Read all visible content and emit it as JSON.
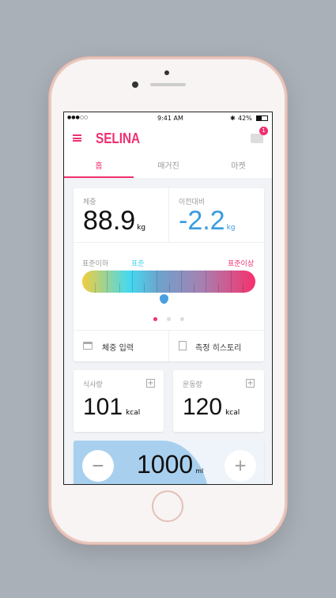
{
  "status": {
    "signal": "●●●○○",
    "time": "9:41 AM",
    "bluetooth": "✱",
    "battery": "42%"
  },
  "header": {
    "brand": "SELINA",
    "badge": "1",
    "accent": "#f0306f"
  },
  "tabs": [
    {
      "label": "홈",
      "active": true
    },
    {
      "label": "매거진"
    },
    {
      "label": "마켓"
    }
  ],
  "weight": {
    "label": "체중",
    "value": "88.9",
    "unit": "kg"
  },
  "change": {
    "label": "이전대비",
    "value": "-2.2",
    "unit": "kg"
  },
  "gauge": {
    "low": "표준이하",
    "normal": "표준",
    "high": "표준이상",
    "position": 0.47,
    "page": 1,
    "pages": 3
  },
  "actions": [
    {
      "label": "체중 입력"
    },
    {
      "label": "측정 히스토리"
    }
  ],
  "food": {
    "label": "식사량",
    "value": "101",
    "unit": "kcal"
  },
  "exercise": {
    "label": "운동량",
    "value": "120",
    "unit": "kcal"
  },
  "water": {
    "value": "1000",
    "unit": "ml",
    "minus": "−",
    "plus": "+"
  }
}
